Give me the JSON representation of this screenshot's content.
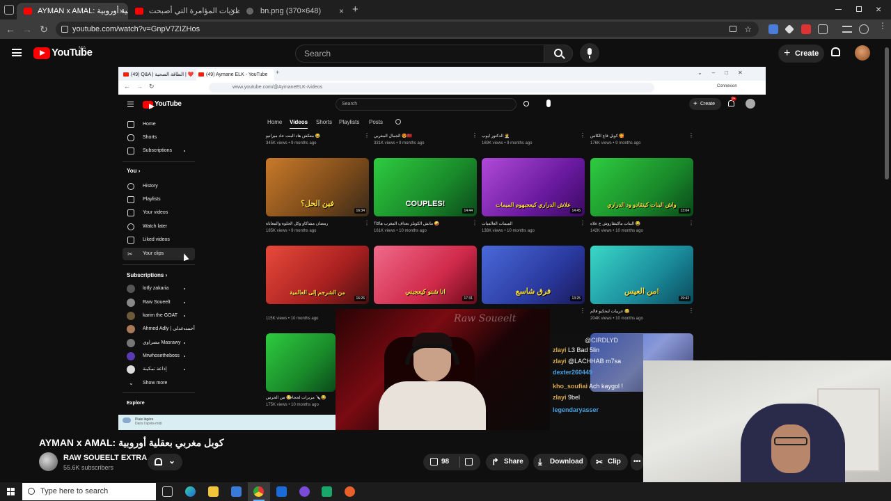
{
  "browser": {
    "tabs": [
      {
        "title": "AYMAN x AMAL: كوبل مغربي بعقلية أوروبية"
      },
      {
        "title": "أبرز نظريات المؤامرة التي أصبحت..."
      },
      {
        "title": "bn.png (370×648)"
      }
    ],
    "url": "youtube.com/watch?v=GnpV7ZIZHos",
    "new_tab": "+",
    "close": "×"
  },
  "yt": {
    "logo_text": "YouTube",
    "region": "MA",
    "search_placeholder": "Search",
    "create_label": "Create"
  },
  "inner": {
    "tabs": [
      "(49) Q&A | الطاقة الصحية | ❤️",
      "(49) Aymane ELK - YouTube"
    ],
    "url": "www.youtube.com/@AymaneELK-/videos",
    "connexion": "Connexion",
    "logo_text": "YouTube",
    "search_placeholder": "Search",
    "create_label": "Create",
    "notif_count": "9+",
    "sidebar": {
      "main": [
        "Home",
        "Shorts",
        "Subscriptions"
      ],
      "you_header": "You",
      "you": [
        "History",
        "Playlists",
        "Your videos",
        "Watch later",
        "Liked videos",
        "Your clips"
      ],
      "subs_header": "Subscriptions",
      "subs": [
        "lotfy zakaria",
        "Raw Soueelt",
        "karim the GOAT",
        "Ahmed Adly | أحمد عدلي",
        "مصراوي Masrawy",
        "Mrwhosetheboss",
        "إذاعة تمكينة"
      ],
      "show_more": "Show more",
      "explore": "Explore"
    },
    "channel_tabs": [
      "Home",
      "Videos",
      "Shorts",
      "Playlists",
      "Posts"
    ],
    "row0": [
      {
        "title": "معكش هاد البنت عاد ميزانيو 😂",
        "meta": "345K views • 9 months ago"
      },
      {
        "title": "الجمال المغربي 😍🇲🇦",
        "meta": "331K views • 9 months ago"
      },
      {
        "title": "الدكتور ايوب 🧑‍⚕️",
        "meta": "169K views • 9 months ago"
      },
      {
        "title": "كوبل قاع الكاس 🥰",
        "meta": "176K views • 9 months ago"
      }
    ],
    "row1": [
      {
        "overlay": "فين الحل؟",
        "duration": "16:34",
        "title": "رمضان مشاكاو وكل الحلوة والمعاناة",
        "meta": "185K views • 9 months ago"
      },
      {
        "overlay": "COUPLES!",
        "duration": "14:44",
        "title": "ماتش الكوبلز بعداف المغرب هاكا؟ 🤪",
        "meta": "161K views • 10 months ago"
      },
      {
        "overlay": "علاش الدراري كيعجبهوم الميمات",
        "duration": "14:45",
        "title": "الميمات العالميات",
        "meta": "138K views • 10 months ago"
      },
      {
        "overlay": "واش البنات كيتقادو ود الدراري",
        "duration": "13:04",
        "title": "البنات ماكيتقاروش ع علاه 😂",
        "meta": "142K views • 10 months ago"
      }
    ],
    "row2": [
      {
        "overlay": "من الشرجم إلى العالمية",
        "duration": "16:26",
        "title": "",
        "meta": "115K views • 10 months ago"
      },
      {
        "overlay": "انا شنو كيعجبني",
        "duration": "17:31",
        "title": "",
        "meta": ""
      },
      {
        "overlay": "فرق شاسع",
        "duration": "13:25",
        "title": "",
        "meta": ""
      },
      {
        "overlay": "من العيس!",
        "duration": "19:42",
        "title": "عربيات لبحكيو فالم 😂",
        "meta": "204K views • 10 months ago"
      }
    ],
    "row3": [
      {
        "title": "من الحرس 😂",
        "meta": "175K views • 10 months ago"
      },
      {
        "title": "مربرات لحجاجة 🔪😂",
        "meta": ""
      }
    ],
    "weather": {
      "line1": "Pluie légère",
      "line2": "Dans l'après-midi"
    }
  },
  "stream": {
    "watermark": "Raw Soueelt",
    "chat": [
      {
        "user": "@CIRDLYD",
        "text": "",
        "color": "#e6e6e6"
      },
      {
        "user": "zlayi",
        "text": "L3 Bad 5lin",
        "color": "#d9a84a"
      },
      {
        "user": "zlayi",
        "text": "@LACHHAB m7sa",
        "color": "#d9a84a"
      },
      {
        "user": "dexter260449",
        "text": "",
        "color": "#4aa0e0"
      },
      {
        "user": "kho_soufiai",
        "text": "Ach kaygol !",
        "color": "#d9a84a"
      },
      {
        "user": "zlayi",
        "text": "9bel",
        "color": "#d9a84a"
      },
      {
        "user": "legendaryasser",
        "text": "",
        "color": "#4aa0e0"
      }
    ]
  },
  "video": {
    "title": "AYMAN x AMAL: كوبل مغربي بعقلية أوروبية",
    "channel": "RAW SOUEELT EXTRA",
    "subscribers": "55.6K subscribers",
    "likes": "98",
    "share_label": "Share",
    "download_label": "Download",
    "clip_label": "Clip",
    "more_label": "•••"
  },
  "taskbar": {
    "search_placeholder": "Type here to search"
  },
  "colors": {
    "yt_red": "#ff0000",
    "bg": "#0f0f0f",
    "chrome_dark": "#1f1f1f"
  }
}
